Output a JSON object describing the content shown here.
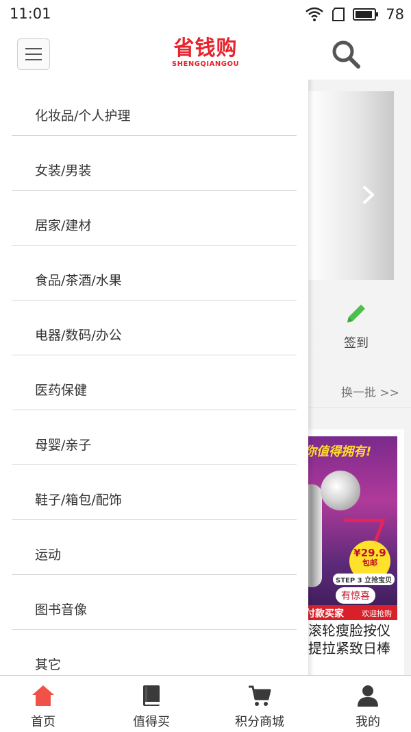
{
  "status_bar": {
    "time": "11:01",
    "battery": "78"
  },
  "header": {
    "logo_main": "省钱购",
    "logo_sub": "SHENGQIANGOU"
  },
  "drawer": {
    "items": [
      {
        "label": "化妆品/个人护理"
      },
      {
        "label": "女装/男装"
      },
      {
        "label": "居家/建材"
      },
      {
        "label": "食品/茶酒/水果"
      },
      {
        "label": "电器/数码/办公"
      },
      {
        "label": "医药保健"
      },
      {
        "label": "母婴/亲子"
      },
      {
        "label": "鞋子/箱包/配饰"
      },
      {
        "label": "运动"
      },
      {
        "label": "图书音像"
      },
      {
        "label": "其它"
      }
    ]
  },
  "background_page": {
    "checkin_label": "签到",
    "refresh_label": "换一批 >>",
    "product": {
      "banner_text": "你值得拥有!",
      "price": "¥29.9",
      "price_sub": "包邮",
      "step_badge": "STEP 3 立抢宝贝",
      "surprise": "有惊喜",
      "buyer_text": "付款买家",
      "buyer_sub": "欢迎抢购",
      "title": "滚轮瘦脸按仪提拉紧致日棒"
    }
  },
  "bottom_nav": {
    "items": [
      {
        "label": "首页",
        "icon": "home-icon",
        "active": true
      },
      {
        "label": "值得买",
        "icon": "book-icon",
        "active": false
      },
      {
        "label": "积分商城",
        "icon": "cart-icon",
        "active": false
      },
      {
        "label": "我的",
        "icon": "user-icon",
        "active": false
      }
    ]
  },
  "colors": {
    "brand_red": "#e8232c",
    "active_nav": "#f0524a",
    "checkin_green": "#4cc04c",
    "nav_icon": "#3a3a3a"
  }
}
